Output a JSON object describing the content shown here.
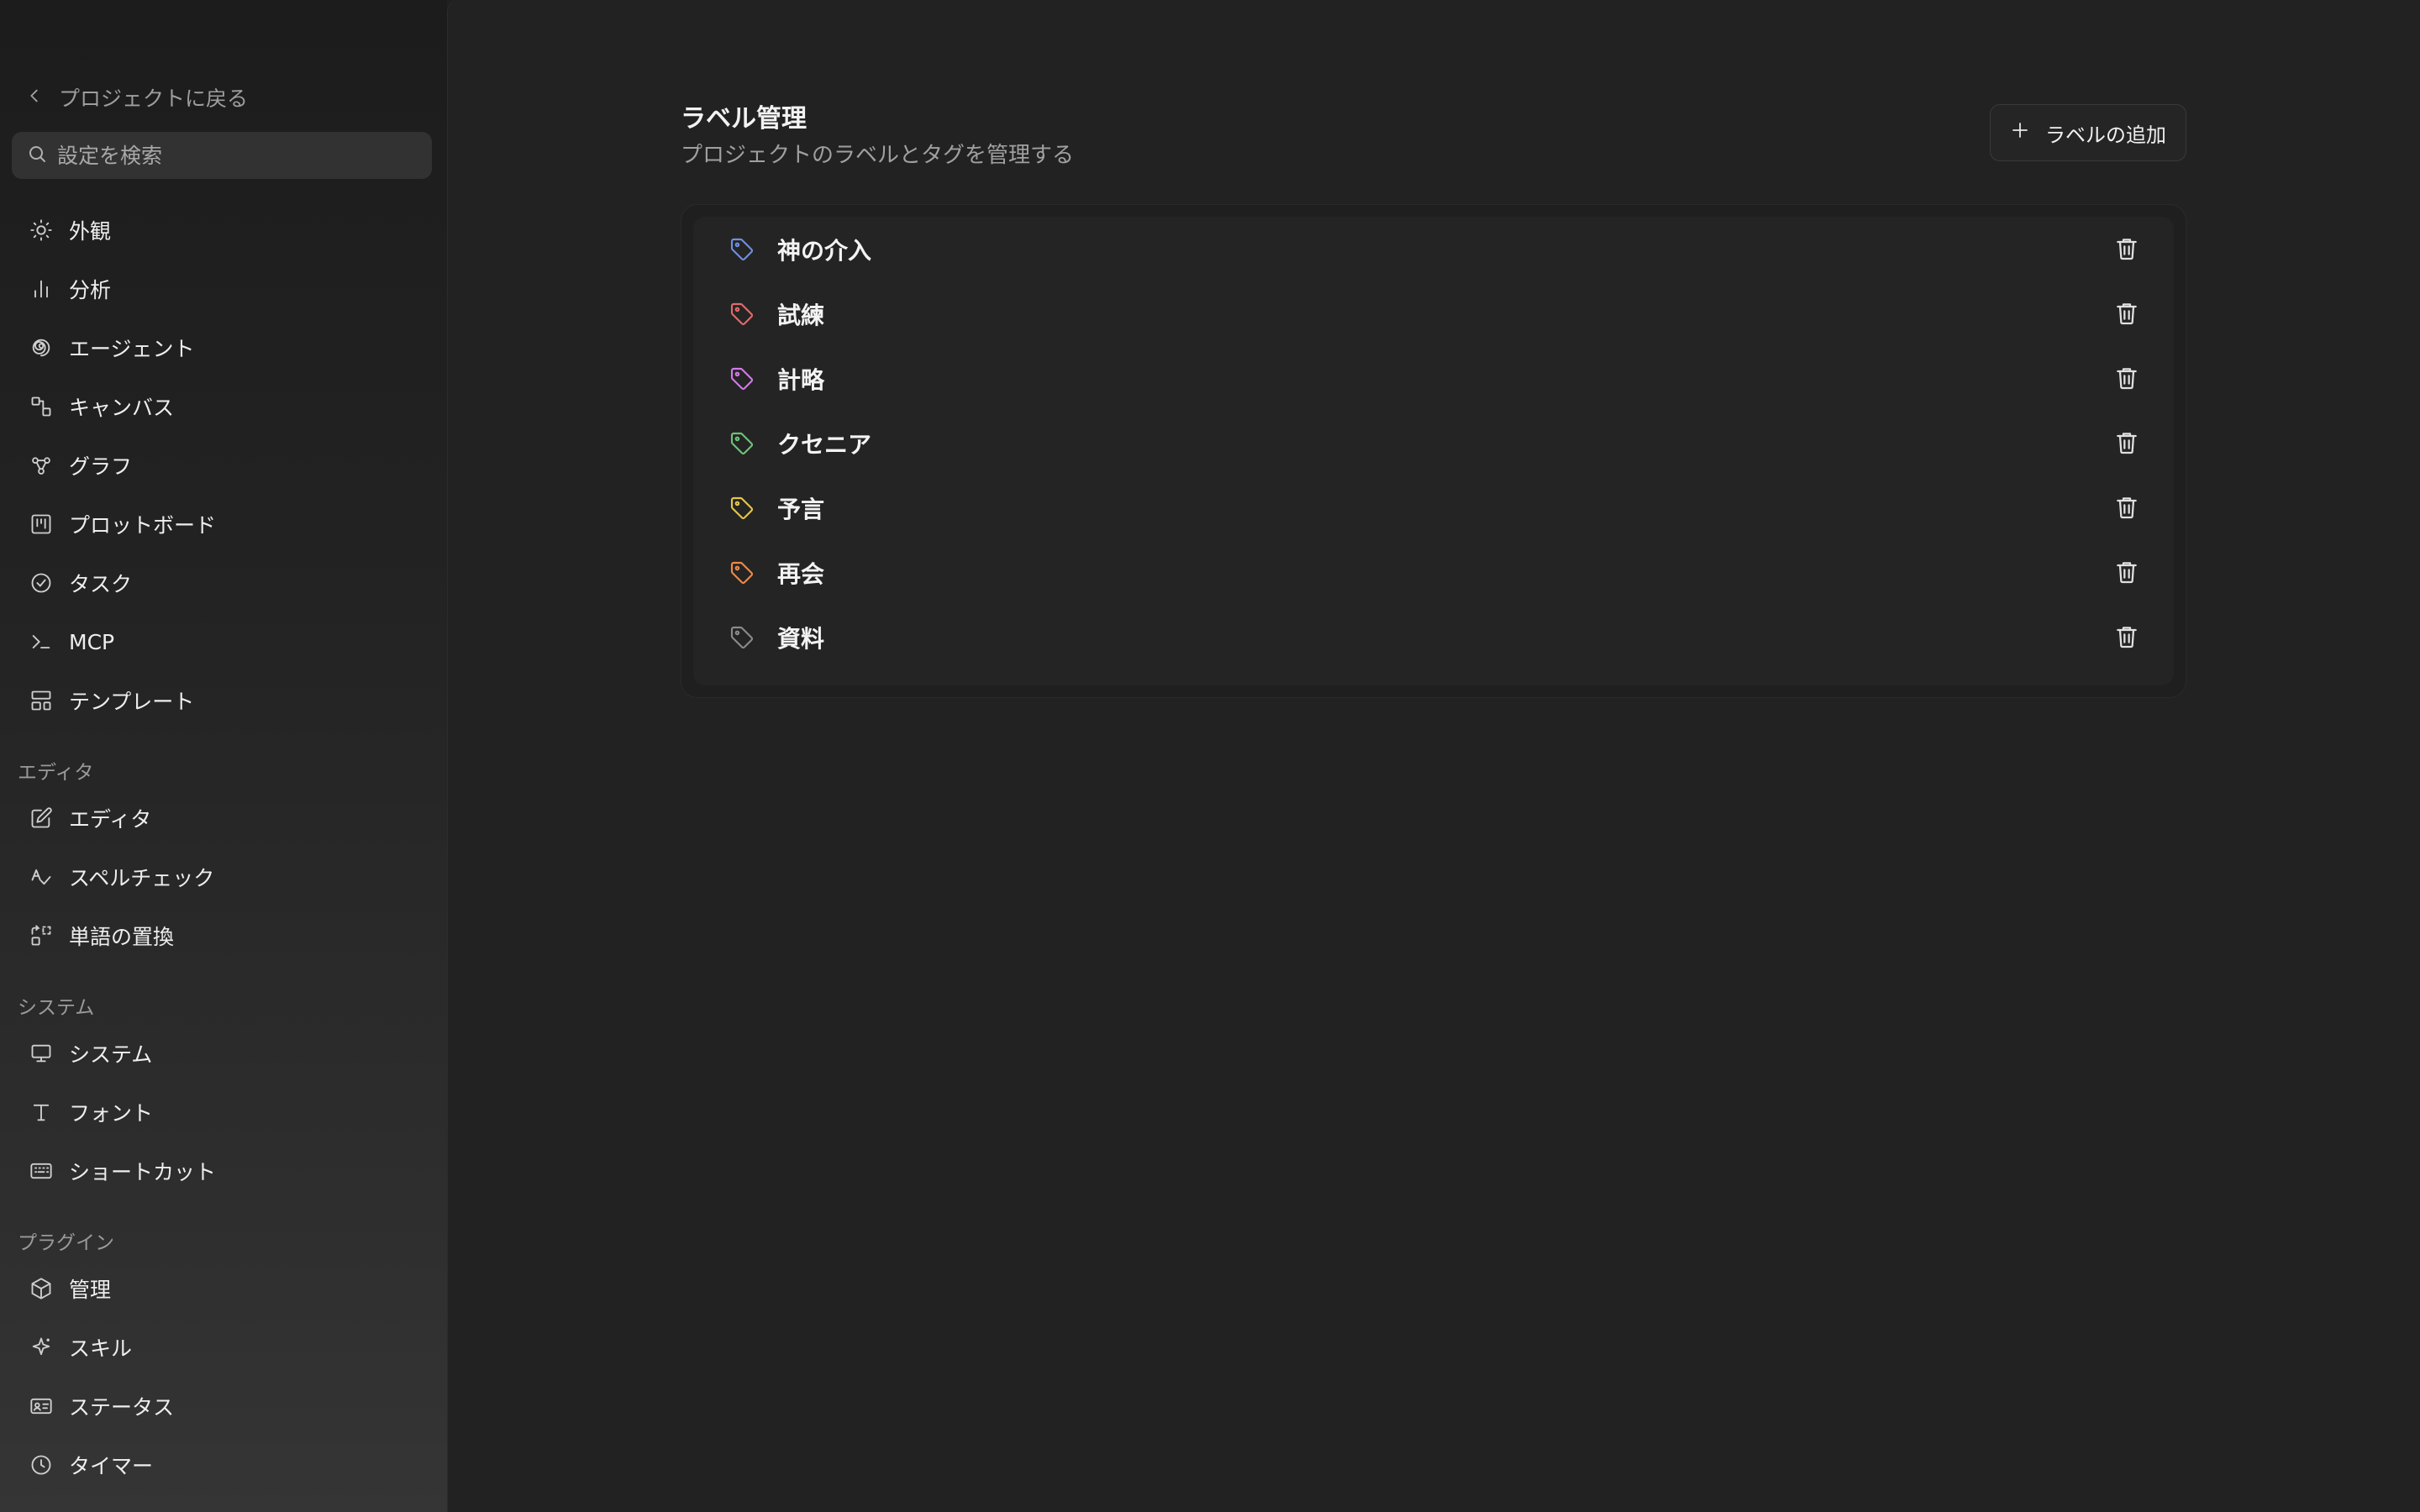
{
  "sidebar": {
    "back_label": "プロジェクトに戻る",
    "search_placeholder": "設定を検索",
    "items": [
      {
        "label": "外観",
        "icon": "sun-icon"
      },
      {
        "label": "分析",
        "icon": "bar-chart-icon"
      },
      {
        "label": "エージェント",
        "icon": "spiral-icon"
      },
      {
        "label": "キャンバス",
        "icon": "canvas-icon"
      },
      {
        "label": "グラフ",
        "icon": "graph-icon"
      },
      {
        "label": "プロットボード",
        "icon": "kanban-icon"
      },
      {
        "label": "タスク",
        "icon": "check-circle-icon"
      },
      {
        "label": "MCP",
        "icon": "terminal-icon"
      },
      {
        "label": "テンプレート",
        "icon": "template-icon"
      }
    ],
    "sections": {
      "editor": {
        "title": "エディタ",
        "items": [
          {
            "label": "エディタ",
            "icon": "edit-icon"
          },
          {
            "label": "スペルチェック",
            "icon": "spellcheck-icon"
          },
          {
            "label": "単語の置換",
            "icon": "replace-icon"
          }
        ]
      },
      "system": {
        "title": "システム",
        "items": [
          {
            "label": "システム",
            "icon": "monitor-icon"
          },
          {
            "label": "フォント",
            "icon": "type-icon"
          },
          {
            "label": "ショートカット",
            "icon": "keyboard-icon"
          }
        ]
      },
      "plugins": {
        "title": "プラグイン",
        "items": [
          {
            "label": "管理",
            "icon": "package-icon"
          },
          {
            "label": "スキル",
            "icon": "sparkle-icon"
          },
          {
            "label": "ステータス",
            "icon": "id-card-icon"
          },
          {
            "label": "タイマー",
            "icon": "clock-icon"
          }
        ]
      }
    }
  },
  "header": {
    "title": "ラベル管理",
    "subtitle": "プロジェクトのラベルとタグを管理する",
    "add_button_label": "ラベルの追加"
  },
  "labels": [
    {
      "name": "神の介入",
      "color": "#6f8fe0"
    },
    {
      "name": "試練",
      "color": "#e06b6b"
    },
    {
      "name": "計略",
      "color": "#d27ae6"
    },
    {
      "name": "クセニア",
      "color": "#6fc27a"
    },
    {
      "name": "予言",
      "color": "#e6c54a"
    },
    {
      "name": "再会",
      "color": "#ee8a45"
    },
    {
      "name": "資料",
      "color": "#8a8a8a"
    }
  ],
  "colors": {
    "background": "#202020",
    "text": "#e8e8e8",
    "muted": "#a0a0a0"
  }
}
